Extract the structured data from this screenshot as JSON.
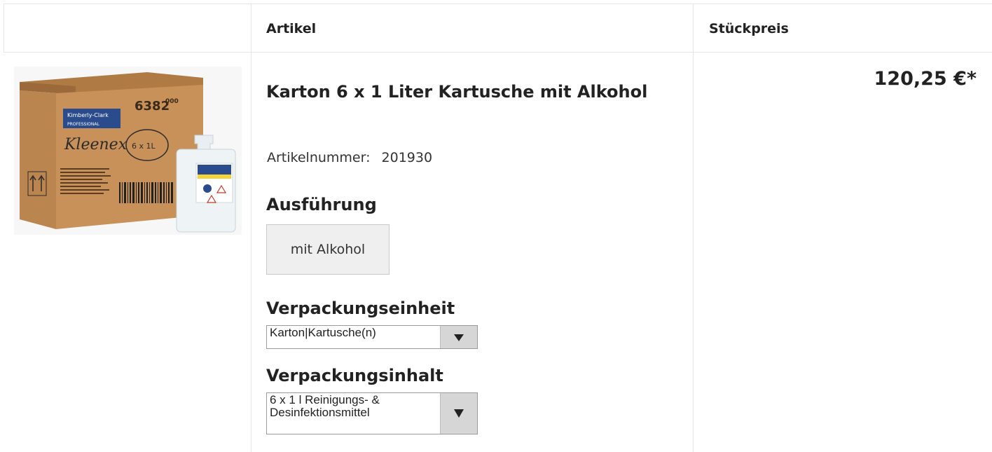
{
  "table": {
    "headers": {
      "image": "",
      "article": "Artikel",
      "unit_price": "Stückpreis"
    }
  },
  "product": {
    "image_label": "Kleenex 6 x 1L cartridge carton",
    "box_text": {
      "brand": "Kleenex",
      "code": "6382",
      "code_sup": "000",
      "pack": "6 x 1L",
      "company": "Kimberly-Clark",
      "sub": "PROFESSIONAL"
    },
    "title": "Karton 6 x 1 Liter Kartusche mit Alkohol",
    "article_number_label": "Artikelnummer:",
    "article_number": "201930",
    "variant_heading": "Ausführung",
    "variant_option": "mit Alkohol",
    "packaging_unit_heading": "Verpackungseinheit",
    "packaging_unit_value": "Karton|Kartusche(n)",
    "packaging_content_heading": "Verpackungsinhalt",
    "packaging_content_value": "6 x 1 l Reinigungs- & Desinfektionsmittel",
    "price": "120,25 €*"
  },
  "icons": {
    "dropdown": "triangle-down-icon"
  },
  "colors": {
    "border": "#e6e6e6",
    "option_bg": "#efefef",
    "select_arrow_bg": "#d6d6d6",
    "carton": "#c8915a"
  }
}
